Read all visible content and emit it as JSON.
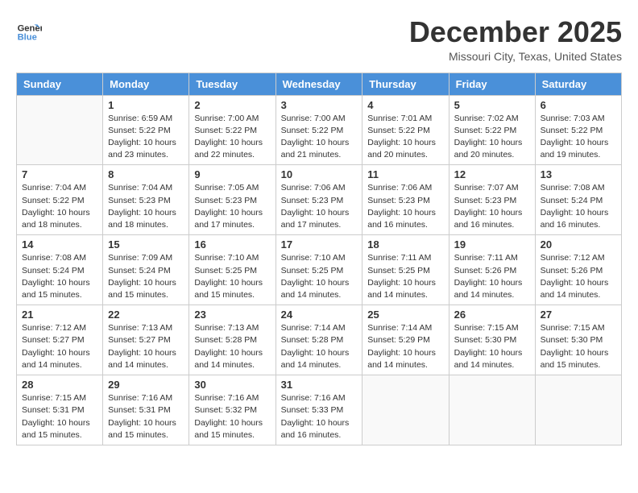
{
  "app": {
    "logo_text_general": "General",
    "logo_text_blue": "Blue"
  },
  "header": {
    "title": "December 2025",
    "location": "Missouri City, Texas, United States"
  },
  "calendar": {
    "weekdays": [
      "Sunday",
      "Monday",
      "Tuesday",
      "Wednesday",
      "Thursday",
      "Friday",
      "Saturday"
    ],
    "weeks": [
      [
        {
          "day": "",
          "info": ""
        },
        {
          "day": "1",
          "info": "Sunrise: 6:59 AM\nSunset: 5:22 PM\nDaylight: 10 hours\nand 23 minutes."
        },
        {
          "day": "2",
          "info": "Sunrise: 7:00 AM\nSunset: 5:22 PM\nDaylight: 10 hours\nand 22 minutes."
        },
        {
          "day": "3",
          "info": "Sunrise: 7:00 AM\nSunset: 5:22 PM\nDaylight: 10 hours\nand 21 minutes."
        },
        {
          "day": "4",
          "info": "Sunrise: 7:01 AM\nSunset: 5:22 PM\nDaylight: 10 hours\nand 20 minutes."
        },
        {
          "day": "5",
          "info": "Sunrise: 7:02 AM\nSunset: 5:22 PM\nDaylight: 10 hours\nand 20 minutes."
        },
        {
          "day": "6",
          "info": "Sunrise: 7:03 AM\nSunset: 5:22 PM\nDaylight: 10 hours\nand 19 minutes."
        }
      ],
      [
        {
          "day": "7",
          "info": "Sunrise: 7:04 AM\nSunset: 5:22 PM\nDaylight: 10 hours\nand 18 minutes."
        },
        {
          "day": "8",
          "info": "Sunrise: 7:04 AM\nSunset: 5:23 PM\nDaylight: 10 hours\nand 18 minutes."
        },
        {
          "day": "9",
          "info": "Sunrise: 7:05 AM\nSunset: 5:23 PM\nDaylight: 10 hours\nand 17 minutes."
        },
        {
          "day": "10",
          "info": "Sunrise: 7:06 AM\nSunset: 5:23 PM\nDaylight: 10 hours\nand 17 minutes."
        },
        {
          "day": "11",
          "info": "Sunrise: 7:06 AM\nSunset: 5:23 PM\nDaylight: 10 hours\nand 16 minutes."
        },
        {
          "day": "12",
          "info": "Sunrise: 7:07 AM\nSunset: 5:23 PM\nDaylight: 10 hours\nand 16 minutes."
        },
        {
          "day": "13",
          "info": "Sunrise: 7:08 AM\nSunset: 5:24 PM\nDaylight: 10 hours\nand 16 minutes."
        }
      ],
      [
        {
          "day": "14",
          "info": "Sunrise: 7:08 AM\nSunset: 5:24 PM\nDaylight: 10 hours\nand 15 minutes."
        },
        {
          "day": "15",
          "info": "Sunrise: 7:09 AM\nSunset: 5:24 PM\nDaylight: 10 hours\nand 15 minutes."
        },
        {
          "day": "16",
          "info": "Sunrise: 7:10 AM\nSunset: 5:25 PM\nDaylight: 10 hours\nand 15 minutes."
        },
        {
          "day": "17",
          "info": "Sunrise: 7:10 AM\nSunset: 5:25 PM\nDaylight: 10 hours\nand 14 minutes."
        },
        {
          "day": "18",
          "info": "Sunrise: 7:11 AM\nSunset: 5:25 PM\nDaylight: 10 hours\nand 14 minutes."
        },
        {
          "day": "19",
          "info": "Sunrise: 7:11 AM\nSunset: 5:26 PM\nDaylight: 10 hours\nand 14 minutes."
        },
        {
          "day": "20",
          "info": "Sunrise: 7:12 AM\nSunset: 5:26 PM\nDaylight: 10 hours\nand 14 minutes."
        }
      ],
      [
        {
          "day": "21",
          "info": "Sunrise: 7:12 AM\nSunset: 5:27 PM\nDaylight: 10 hours\nand 14 minutes."
        },
        {
          "day": "22",
          "info": "Sunrise: 7:13 AM\nSunset: 5:27 PM\nDaylight: 10 hours\nand 14 minutes."
        },
        {
          "day": "23",
          "info": "Sunrise: 7:13 AM\nSunset: 5:28 PM\nDaylight: 10 hours\nand 14 minutes."
        },
        {
          "day": "24",
          "info": "Sunrise: 7:14 AM\nSunset: 5:28 PM\nDaylight: 10 hours\nand 14 minutes."
        },
        {
          "day": "25",
          "info": "Sunrise: 7:14 AM\nSunset: 5:29 PM\nDaylight: 10 hours\nand 14 minutes."
        },
        {
          "day": "26",
          "info": "Sunrise: 7:15 AM\nSunset: 5:30 PM\nDaylight: 10 hours\nand 14 minutes."
        },
        {
          "day": "27",
          "info": "Sunrise: 7:15 AM\nSunset: 5:30 PM\nDaylight: 10 hours\nand 15 minutes."
        }
      ],
      [
        {
          "day": "28",
          "info": "Sunrise: 7:15 AM\nSunset: 5:31 PM\nDaylight: 10 hours\nand 15 minutes."
        },
        {
          "day": "29",
          "info": "Sunrise: 7:16 AM\nSunset: 5:31 PM\nDaylight: 10 hours\nand 15 minutes."
        },
        {
          "day": "30",
          "info": "Sunrise: 7:16 AM\nSunset: 5:32 PM\nDaylight: 10 hours\nand 15 minutes."
        },
        {
          "day": "31",
          "info": "Sunrise: 7:16 AM\nSunset: 5:33 PM\nDaylight: 10 hours\nand 16 minutes."
        },
        {
          "day": "",
          "info": ""
        },
        {
          "day": "",
          "info": ""
        },
        {
          "day": "",
          "info": ""
        }
      ]
    ]
  }
}
